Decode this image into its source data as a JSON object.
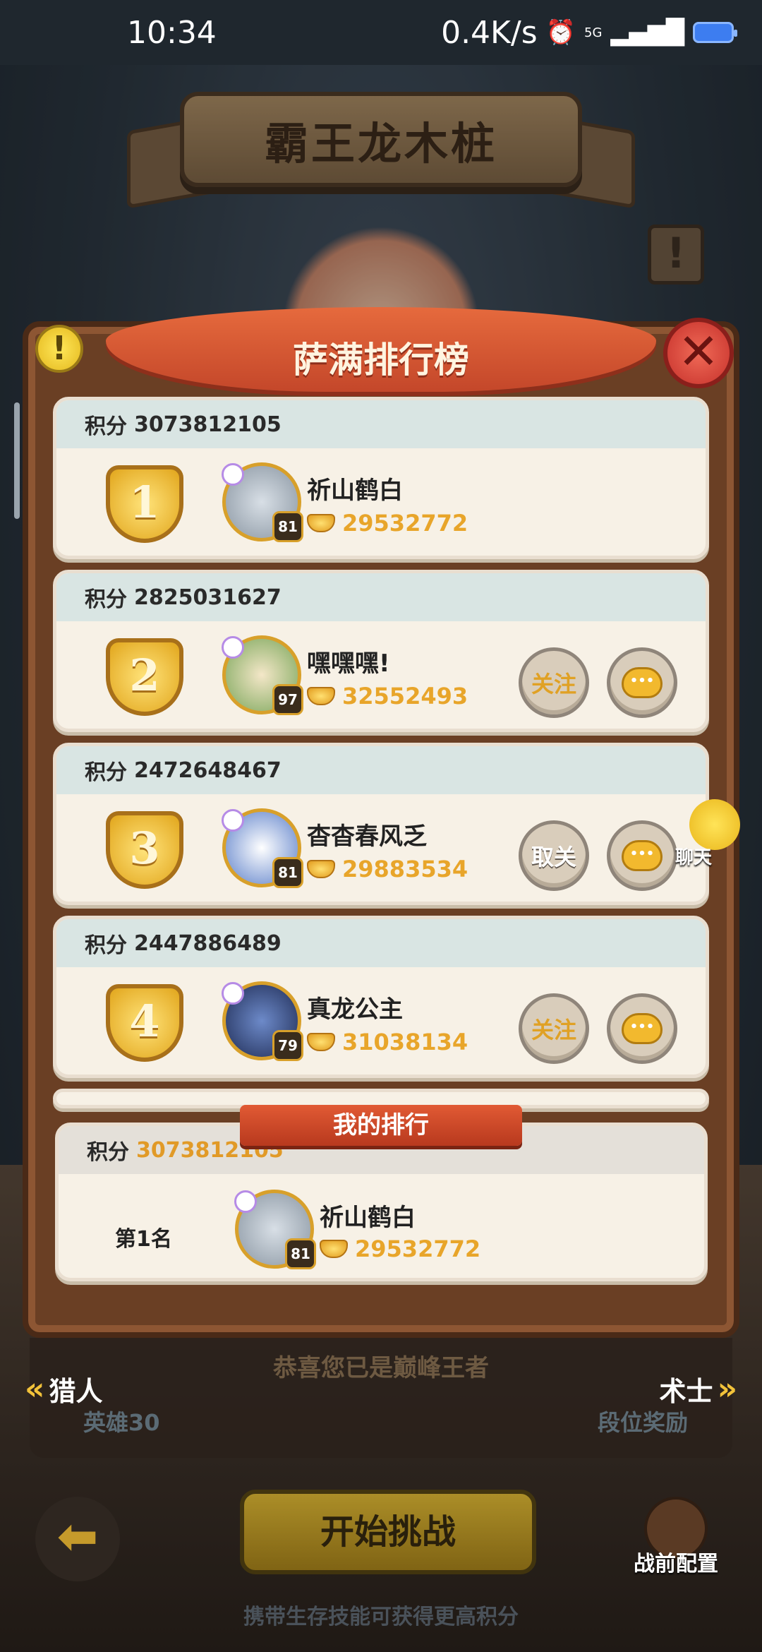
{
  "status_bar": {
    "time": "10:34",
    "net_speed": "0.4K/s",
    "signal": "5G"
  },
  "header": {
    "title": "霸王龙木桩",
    "board_title": "萨满排行榜",
    "warn_icon": "!",
    "close_icon": "✕"
  },
  "leaderboard": {
    "entries": [
      {
        "rank": "1",
        "score_label": "积分",
        "score": "3073812105",
        "level": "81",
        "name": "祈山鹤白",
        "power": "29532772"
      },
      {
        "rank": "2",
        "score_label": "积分",
        "score": "2825031627",
        "level": "97",
        "name": "嘿嘿嘿!",
        "power": "32552493",
        "follow": "关注",
        "chat": "•••"
      },
      {
        "rank": "3",
        "score_label": "积分",
        "score": "2472648467",
        "level": "81",
        "name": "杳杳春风乏",
        "power": "29883534",
        "follow": "取关",
        "chat": "•••"
      },
      {
        "rank": "4",
        "score_label": "积分",
        "score": "2447886489",
        "level": "79",
        "name": "真龙公主",
        "power": "31038134",
        "follow": "关注",
        "chat": "•••"
      }
    ]
  },
  "floating_chat": {
    "label": "聊天"
  },
  "my_rank": {
    "ribbon": "我的排行",
    "score_label": "积分",
    "score": "3073812105",
    "rank_text": "第1名",
    "level": "81",
    "name": "祈山鹤白",
    "power": "29532772"
  },
  "bottom": {
    "congrats": "恭喜您已是巅峰王者",
    "prev_class": "猎人",
    "next_class": "术士",
    "prev_sub": "英雄30",
    "next_sub": "段位奖励",
    "start_button": "开始挑战",
    "prebattle": "战前配置",
    "hint": "携带生存技能可获得更高积分"
  },
  "colors": {
    "accent_gold": "#e8a52a",
    "ribbon_red": "#c4472a",
    "panel_brown": "#6a3f24"
  }
}
